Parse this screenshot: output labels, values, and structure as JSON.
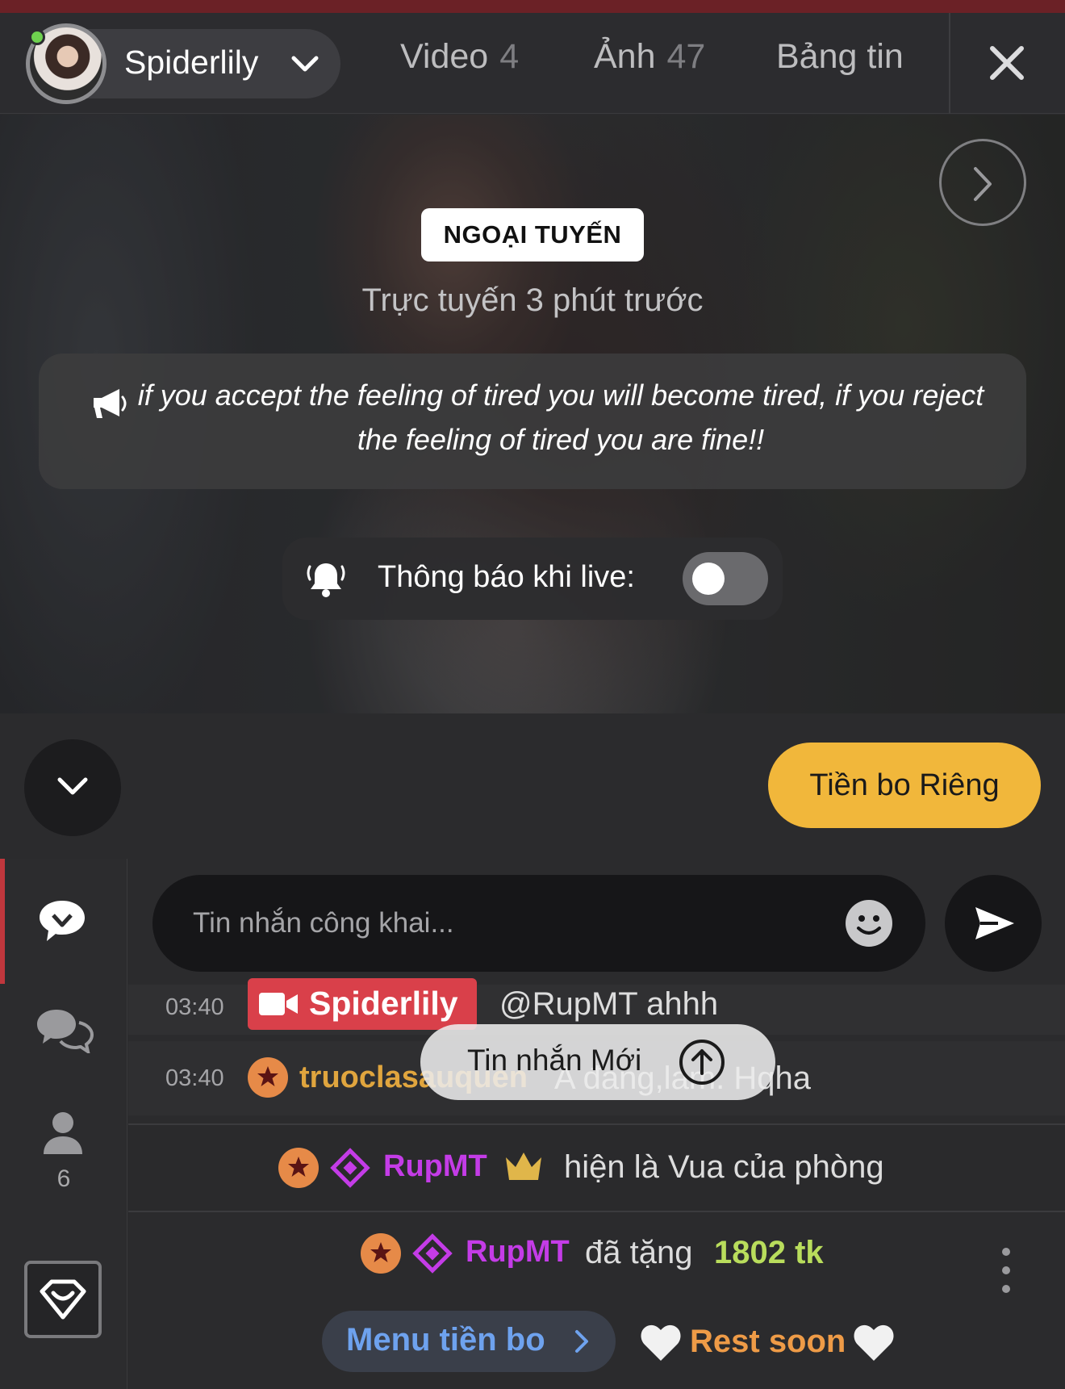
{
  "header": {
    "username": "Spiderlily",
    "tabs": [
      {
        "label": "Video",
        "count": "4"
      },
      {
        "label": "Ảnh",
        "count": "47"
      },
      {
        "label": "Bảng tin",
        "count": ""
      }
    ]
  },
  "hero": {
    "status_badge": "NGOẠI TUYẾN",
    "last_online": "Trực tuyến 3 phút trước",
    "announcement": "if you accept the feeling of tired you will become tired, if you reject the feeling of tired you are fine!!",
    "notify_label": "Thông báo khi live:",
    "notify_enabled": false
  },
  "actions": {
    "private_tip_label": "Tiền bo Riêng"
  },
  "sidebar": {
    "viewer_count": "6"
  },
  "chat": {
    "input_placeholder": "Tin nhắn công khai...",
    "new_messages_label": "Tin nhắn Mới",
    "messages": [
      {
        "time": "03:40",
        "user": "Spiderlily",
        "text": "@RupMT  ahhh"
      },
      {
        "time": "03:40",
        "user": "truoclasauquen",
        "text": "A đang,lam. Hqha"
      }
    ],
    "king_notice": {
      "user": "RupMT",
      "text": "hiện là Vua của phòng"
    },
    "tip_notice": {
      "user": "RupMT",
      "verb": "đã tặng",
      "amount": "1802 tk"
    },
    "tip_menu_label": "Menu tiền bo",
    "tip_message": "Rest soon"
  },
  "colors": {
    "accent_red": "#d9404a",
    "tip_yellow": "#f1b73b",
    "royal_purple": "#c43ce7",
    "token_green": "#b9dd5c",
    "rest_orange": "#ee9b47"
  }
}
